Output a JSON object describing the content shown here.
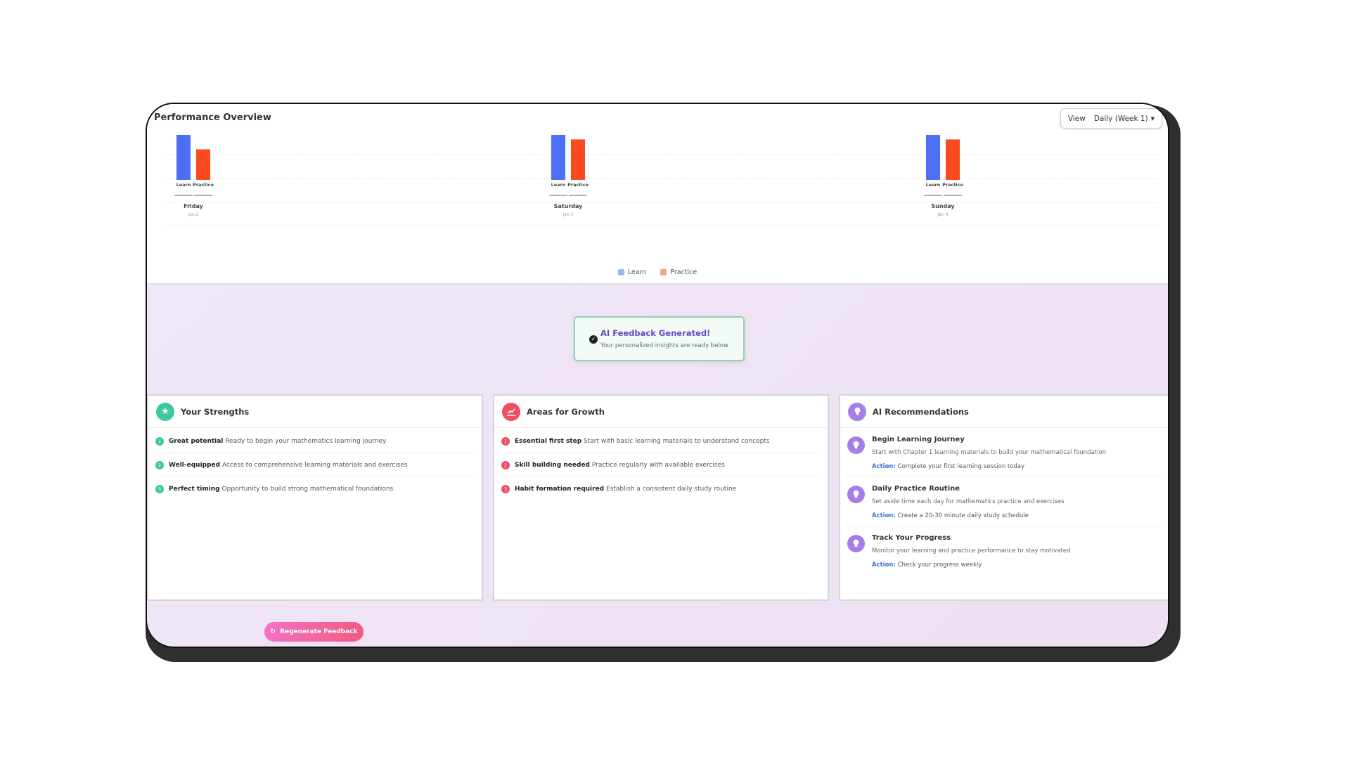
{
  "performance": {
    "title": "Performance Overview",
    "view_label": "View",
    "view_value": "Daily (Week 1)"
  },
  "chart_data": {
    "type": "bar",
    "categories": [
      {
        "day": "Friday",
        "date": "Jan 2"
      },
      {
        "day": "Saturday",
        "date": "Jan 3"
      },
      {
        "day": "Sunday",
        "date": "Jan 4"
      }
    ],
    "series": [
      {
        "name": "Learn",
        "color": "#4f6ef7",
        "values": [
          1.0,
          1.0,
          1.0
        ]
      },
      {
        "name": "Practice",
        "color": "#fb4a1f",
        "values": [
          0.68,
          0.9,
          0.9
        ]
      }
    ],
    "bar_labels": [
      "Learn",
      "Practice"
    ],
    "legend": [
      {
        "label": "Learn",
        "color": "#9bb6f2"
      },
      {
        "label": "Practice",
        "color": "#f7a486"
      }
    ],
    "legend_position": "bottom-center",
    "grid": true
  },
  "toast": {
    "title": "AI Feedback Generated!",
    "subtitle": "Your personalized insights are ready below",
    "icon": "check-circle-icon"
  },
  "strengths": {
    "title": "Your Strengths",
    "icon": "star-icon",
    "color": "#3fc7a3",
    "items": [
      {
        "num": "1",
        "bold": "Great potential",
        "text": "Ready to begin your mathematics learning journey"
      },
      {
        "num": "2",
        "bold": "Well-equipped",
        "text": "Access to comprehensive learning materials and exercises"
      },
      {
        "num": "3",
        "bold": "Perfect timing",
        "text": "Opportunity to build strong mathematical foundations"
      }
    ]
  },
  "growth": {
    "title": "Areas for Growth",
    "icon": "chart-line-icon",
    "color": "#ef4f63",
    "items": [
      {
        "num": "1",
        "bold": "Essential first step",
        "text": "Start with basic learning materials to understand concepts"
      },
      {
        "num": "2",
        "bold": "Skill building needed",
        "text": "Practice regularly with available exercises"
      },
      {
        "num": "3",
        "bold": "Habit formation required",
        "text": "Establish a consistent daily study routine"
      }
    ]
  },
  "recommendations": {
    "title": "AI Recommendations",
    "icon": "lightbulb-icon",
    "color": "#a57ee6",
    "action_label": "Action:",
    "items": [
      {
        "title": "Begin Learning Journey",
        "desc": "Start with Chapter 1 learning materials to build your mathematical foundation",
        "action": "Complete your first learning session today"
      },
      {
        "title": "Daily Practice Routine",
        "desc": "Set aside time each day for mathematics practice and exercises",
        "action": "Create a 20-30 minute daily study schedule"
      },
      {
        "title": "Track Your Progress",
        "desc": "Monitor your learning and practice performance to stay motivated",
        "action": "Check your progress weekly"
      }
    ]
  },
  "regenerate_label": "Regenerate Feedback"
}
